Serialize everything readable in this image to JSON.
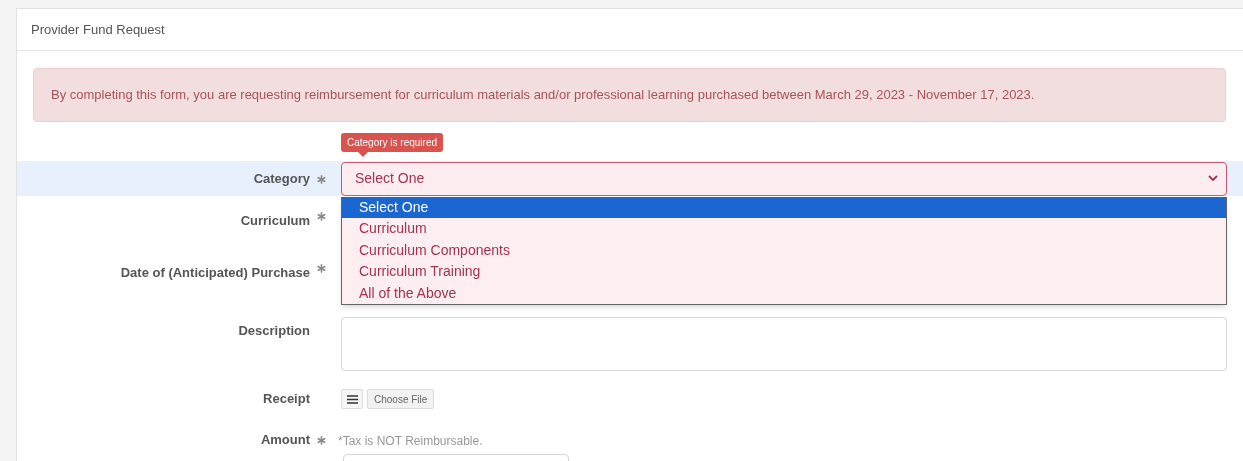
{
  "card": {
    "title": "Provider Fund Request"
  },
  "alert": "By completing this form, you are requesting reimbursement for curriculum materials and/or professional learning purchased between March 29, 2023 - November 17, 2023.",
  "fields": [
    {
      "kind": "select",
      "label": "Category",
      "required": true,
      "focused": true,
      "invalid": true,
      "error": "Category is required",
      "value": "Select One",
      "expanded": true,
      "options": [
        {
          "label": "Select One",
          "selected": true
        },
        {
          "label": "Curriculum",
          "selected": false
        },
        {
          "label": "Curriculum Components",
          "selected": false
        },
        {
          "label": "Curriculum Training",
          "selected": false
        },
        {
          "label": "All of the Above",
          "selected": false
        }
      ]
    },
    {
      "kind": "hidden",
      "label": "Curriculum",
      "required": true
    },
    {
      "kind": "hidden",
      "label": "Date of (Anticipated) Purchase",
      "required": true
    },
    {
      "kind": "textarea",
      "label": "Description",
      "required": false
    },
    {
      "kind": "file",
      "label": "Receipt",
      "required": false,
      "button": "Choose File"
    },
    {
      "kind": "amount",
      "label": "Amount",
      "required": true,
      "note": "*Tax is NOT Reimbursable."
    }
  ]
}
